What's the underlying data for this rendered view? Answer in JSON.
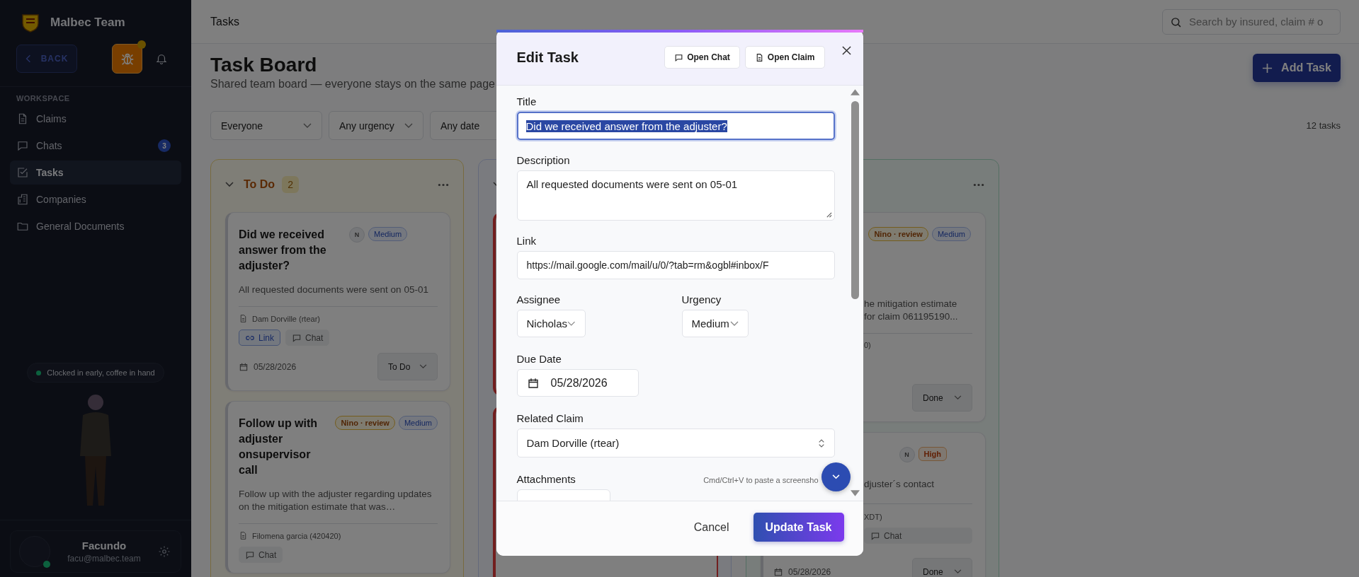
{
  "sidebar": {
    "team_name": "Malbec Team",
    "back_button": "BACK",
    "bug_report_badge": true,
    "section_label": "WORKSPACE",
    "items": [
      {
        "label": "Claims",
        "selected": false
      },
      {
        "label": "Chats",
        "selected": false,
        "badge": "3"
      },
      {
        "label": "Tasks",
        "selected": true
      },
      {
        "label": "Companies",
        "selected": false
      },
      {
        "label": "General Documents",
        "selected": false
      }
    ],
    "status_message": "Clocked in early, coffee in hand",
    "user": {
      "name": "Facundo",
      "email": "facu@malbec.team",
      "online": true
    }
  },
  "header": {
    "title": "Tasks",
    "search": {
      "placeholder": "Search by insured, claim # o"
    }
  },
  "board": {
    "title": "Task Board",
    "subtitle": "Shared team board — everyone stays on the same page",
    "add_button": "Add Task",
    "filters": [
      "Everyone",
      "Any urgency",
      "Any date"
    ],
    "task_count": "12 tasks",
    "columns": [
      {
        "kind": "todo",
        "title": "To Do",
        "count": "2",
        "cards": [
          {
            "title": "Did we received answer from the adjuster?",
            "assignee": "N",
            "badges": [
              {
                "label": "Medium",
                "kind": "medium"
              }
            ],
            "description": "All requested documents were sent on 05-01",
            "claim": "Dam Dorville (rtear)",
            "actions": [
              {
                "label": "Link",
                "kind": "link"
              },
              {
                "label": "Chat",
                "kind": "chat"
              }
            ],
            "due_date": "05/28/2026",
            "status": "To Do"
          },
          {
            "title": "Follow up with adjuster onsupervisor call",
            "badges": [
              {
                "label": "Nino · review",
                "kind": "review"
              },
              {
                "label": "Medium",
                "kind": "medium"
              }
            ],
            "description": "Follow up with the adjuster regarding updates on the mitigation estimate that was…",
            "claim": "Filomena garcia (420420)",
            "actions": [
              {
                "label": "Chat",
                "kind": "chat"
              }
            ]
          }
        ]
      },
      {
        "kind": "overdue"
      },
      {
        "kind": "done",
        "cards": [
          {
            "badges": [
              {
                "label": "Nino · review",
                "kind": "review"
              },
              {
                "label": "Medium",
                "kind": "medium"
              }
            ],
            "description_lines": [
              "he mitigation estimate",
              "for claim 061195190..."
            ],
            "claim": "0)",
            "status": "Done"
          },
          {
            "assignee": "N",
            "badges": [
              {
                "label": "High",
                "kind": "high"
              }
            ],
            "description_lines": [
              "djuster´s contact"
            ],
            "claim": "XDT)",
            "actions": [
              {
                "label": "Chat",
                "kind": "chat"
              }
            ],
            "status": "Done",
            "due_date": "05/28/2026"
          }
        ]
      }
    ]
  },
  "modal": {
    "title": "Edit Task",
    "header_buttons": [
      "Open Chat",
      "Open Claim"
    ],
    "fields": {
      "title": {
        "label": "Title",
        "value": "Did we received answer from the adjuster?",
        "text_selected": true
      },
      "description": {
        "label": "Description",
        "value": "All requested documents were sent on 05-01"
      },
      "link": {
        "label": "Link",
        "value": "https://mail.google.com/mail/u/0/?tab=rm&ogbl#inbox/F"
      },
      "assignee": {
        "label": "Assignee",
        "value": "Nicholas"
      },
      "urgency": {
        "label": "Urgency",
        "value": "Medium"
      },
      "due_date": {
        "label": "Due Date",
        "value": "05/28/2026"
      },
      "related_claim": {
        "label": "Related Claim",
        "value": "Dam Dorville (rtear)"
      },
      "attachments": {
        "label": "Attachments",
        "hint": "Cmd/Ctrl+V to paste a screensho"
      }
    },
    "cancel_button": "Cancel",
    "submit_button": "Update Task"
  }
}
